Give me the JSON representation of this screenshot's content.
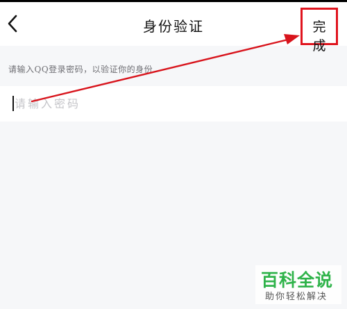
{
  "header": {
    "title": "身份验证",
    "back_icon": "chevron-left-icon",
    "done_label": "完成"
  },
  "form": {
    "hint": "请输入QQ登录密码，以验证你的身份",
    "password_placeholder": "请输入密码",
    "password_value": ""
  },
  "colors": {
    "highlight": "#e0141e",
    "arrow": "#d8141c",
    "watermark_green": "#2fb34a"
  },
  "watermark": {
    "main": "百科全说",
    "sub": "助你轻松解决"
  }
}
